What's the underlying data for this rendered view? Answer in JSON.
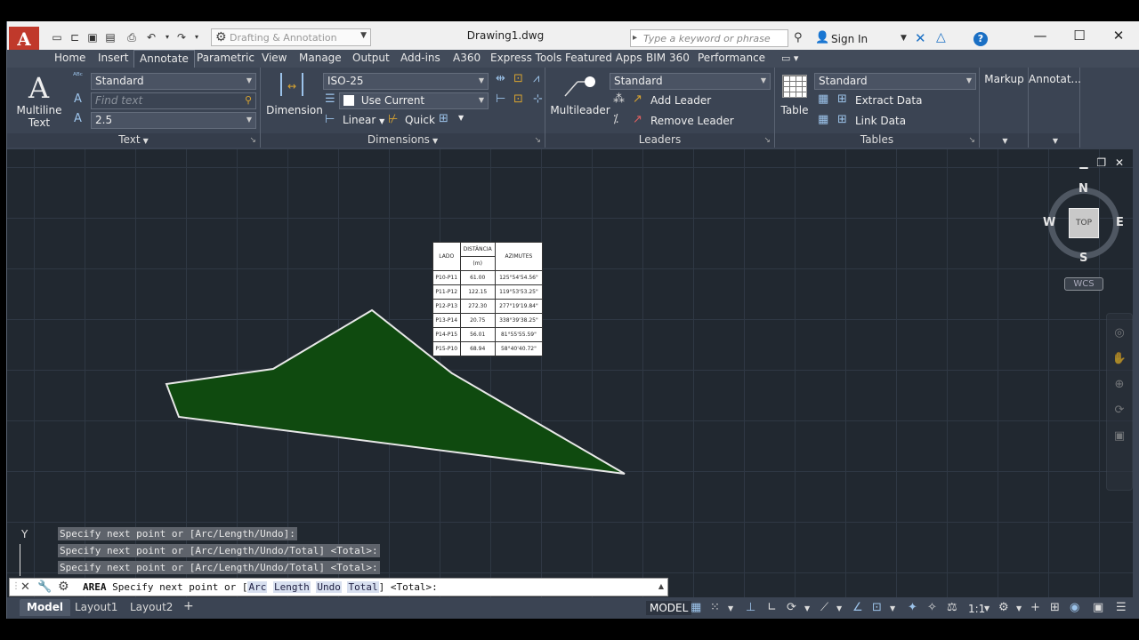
{
  "titlebar": {
    "app_logo": "A",
    "workspace": "Drafting & Annotation",
    "document_title": "Drawing1.dwg",
    "search_placeholder": "Type a keyword or phrase",
    "sign_in": "Sign In"
  },
  "tabs": [
    {
      "label": "Home"
    },
    {
      "label": "Insert"
    },
    {
      "label": "Annotate"
    },
    {
      "label": "Parametric"
    },
    {
      "label": "View"
    },
    {
      "label": "Manage"
    },
    {
      "label": "Output"
    },
    {
      "label": "Add-ins"
    },
    {
      "label": "A360"
    },
    {
      "label": "Express Tools"
    },
    {
      "label": "Featured Apps"
    },
    {
      "label": "BIM 360"
    },
    {
      "label": "Performance"
    }
  ],
  "active_tab": "Annotate",
  "ribbon": {
    "text_panel": {
      "title": "Text",
      "multiline_text_label": "Multiline\nText",
      "multiline_line1": "Multiline",
      "multiline_line2": "Text",
      "text_style": "Standard",
      "find_placeholder": "Find text",
      "text_height": "2.5"
    },
    "dimensions_panel": {
      "title": "Dimensions",
      "dimension_label": "Dimension",
      "dim_style": "ISO-25",
      "layer": "Use Current",
      "linear_label": "Linear",
      "quick_label": "Quick"
    },
    "leaders_panel": {
      "title": "Leaders",
      "multileader_label": "Multileader",
      "leader_style": "Standard",
      "add_leader": "Add Leader",
      "remove_leader": "Remove Leader"
    },
    "tables_panel": {
      "title": "Tables",
      "table_label": "Table",
      "table_style": "Standard",
      "extract_data": "Extract Data",
      "link_data": "Link Data"
    },
    "markup_panel": {
      "title": "Markup"
    },
    "annotate_panel": {
      "title": "Annotat..."
    }
  },
  "viewcube": {
    "top": "TOP",
    "north": "N",
    "south": "S",
    "east": "E",
    "west": "W",
    "wcs": "WCS"
  },
  "drawing_table": {
    "headers": [
      "LADO",
      "DISTÂNCIA",
      "AZIMUTES"
    ],
    "unit": "(m)",
    "rows": [
      [
        "P10-P11",
        "61.00",
        "125°54'54.56\""
      ],
      [
        "P11-P12",
        "122.15",
        "119°53'53.25\""
      ],
      [
        "P12-P13",
        "272.30",
        "277°19'19.84\""
      ],
      [
        "P13-P14",
        "20.75",
        "338°39'38.25\""
      ],
      [
        "P14-P15",
        "56.01",
        "81°55'55.59\""
      ],
      [
        "P15-P10",
        "68.94",
        "58°40'40.72\""
      ]
    ]
  },
  "command_history": [
    "Specify next point or [Arc/Length/Undo]:",
    "Specify next point or [Arc/Length/Undo/Total] <Total>:",
    "Specify next point or [Arc/Length/Undo/Total] <Total>:"
  ],
  "command_line": {
    "command": "AREA",
    "prompt": "Specify next point or [",
    "options": [
      "Arc",
      "Length",
      "Undo",
      "Total"
    ],
    "suffix": "] <Total>:"
  },
  "ucs_label": "Y",
  "layout_tabs": [
    {
      "label": "Model"
    },
    {
      "label": "Layout1"
    },
    {
      "label": "Layout2"
    }
  ],
  "add_layout": "+",
  "status": {
    "model": "MODEL",
    "scale": "1:1"
  },
  "colors": {
    "polygon_fill": "#0f4a0f",
    "polygon_stroke": "#e8e8e8",
    "accent": "#1a6fc4",
    "logo": "#c0392b"
  }
}
